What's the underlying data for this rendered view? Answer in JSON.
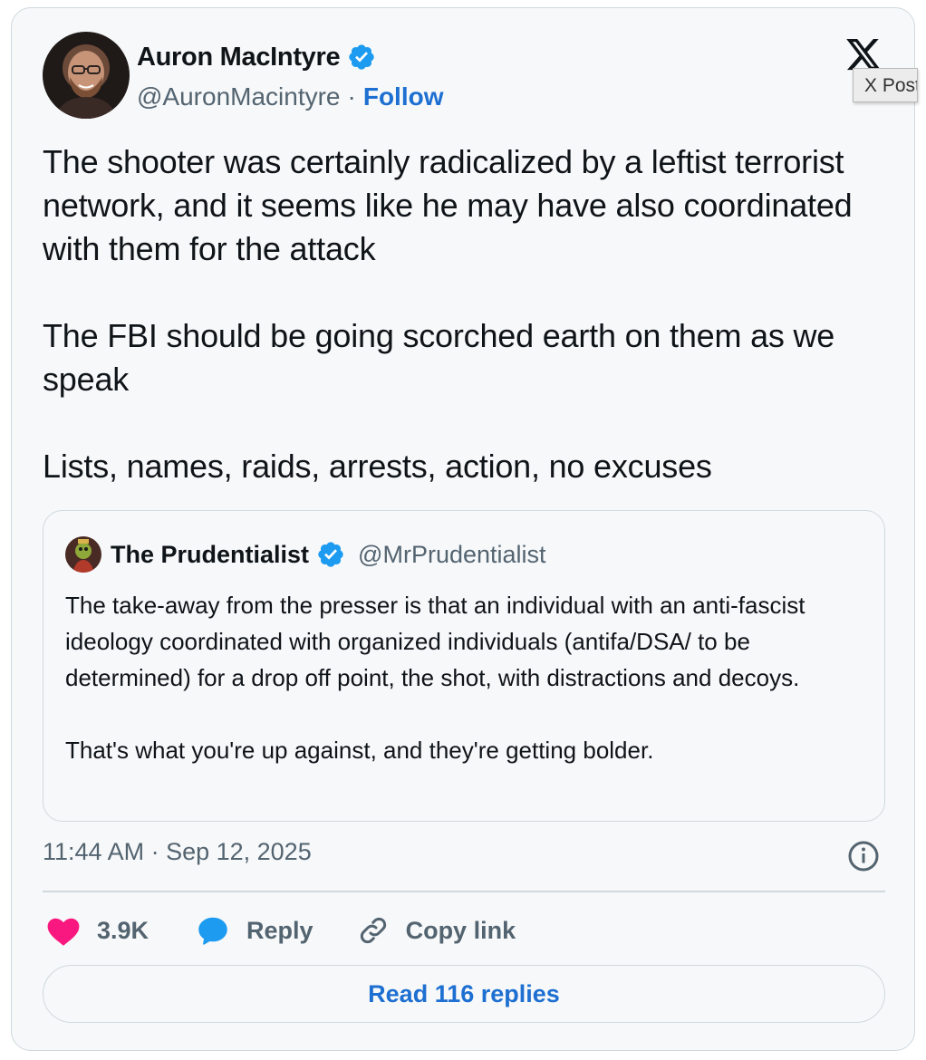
{
  "tweet": {
    "author": {
      "name": "Auron MacIntyre",
      "handle": "@AuronMacintyre",
      "separator": "·",
      "follow_label": "Follow"
    },
    "x_tooltip": "X Post",
    "text": {
      "p1": "The shooter was certainly radicalized by a leftist terrorist network, and it seems like he may have also coordinated with them for the attack",
      "p2": "The FBI should be going scorched earth on them as we speak",
      "p3": "Lists, names, raids, arrests, action, no excuses"
    },
    "quote": {
      "name": "The Prudentialist",
      "handle": "@MrPrudentialist",
      "p1": "The take-away from the presser is that an individual with an anti-fascist ideology coordinated with organized individuals (antifa/DSA/ to be determined) for a drop off point, the shot, with distractions and decoys.",
      "p2": "That's what you're up against, and they're getting bolder."
    },
    "timestamp": "11:44 AM · Sep 12, 2025",
    "actions": {
      "like_count": "3.9K",
      "reply_label": "Reply",
      "copy_link_label": "Copy link"
    },
    "read_replies_label": "Read 116 replies"
  },
  "icons": {
    "verified": "verified-badge-icon",
    "x_logo": "x-logo-icon",
    "info": "info-icon",
    "heart": "heart-icon",
    "reply": "reply-bubble-icon",
    "link": "link-icon"
  },
  "colors": {
    "accent": "#1d6fd1",
    "verified": "#1d9bf0",
    "heart": "#f91880",
    "secondary_text": "#536471",
    "border": "#cfd9de"
  }
}
